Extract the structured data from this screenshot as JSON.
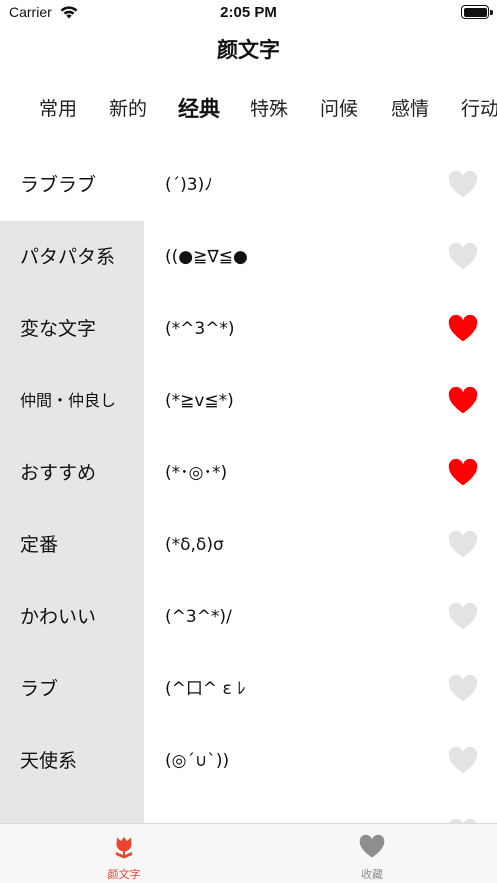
{
  "status_bar": {
    "carrier": "Carrier",
    "time": "2:05 PM"
  },
  "nav": {
    "title": "颜文字"
  },
  "categories": [
    {
      "label": "常用",
      "active": false
    },
    {
      "label": "新的",
      "active": false
    },
    {
      "label": "经典",
      "active": true
    },
    {
      "label": "特殊",
      "active": false
    },
    {
      "label": "问候",
      "active": false
    },
    {
      "label": "感情",
      "active": false
    },
    {
      "label": "行动",
      "active": false
    }
  ],
  "rows": [
    {
      "name": "ラブラブ",
      "kaomoji": "(´)3)ﾉ",
      "favorited": false
    },
    {
      "name": "パタパタ系",
      "kaomoji": "((●≧∇≦●",
      "favorited": false
    },
    {
      "name": "変な文字",
      "kaomoji": "(*^3^*)",
      "favorited": true
    },
    {
      "name": "仲間・仲良し",
      "kaomoji": "(*≧v≦*)",
      "favorited": true
    },
    {
      "name": "おすすめ",
      "kaomoji": "(*･◎･*)",
      "favorited": true
    },
    {
      "name": "定番",
      "kaomoji": "(*δ,δ)σ",
      "favorited": false
    },
    {
      "name": "かわいい",
      "kaomoji": "(^3^*)/",
      "favorited": false
    },
    {
      "name": "ラブ",
      "kaomoji": "(^口^ ε ﾚ",
      "favorited": false
    },
    {
      "name": "天使系",
      "kaomoji": "(◎´∪`))",
      "favorited": false
    },
    {
      "name": "",
      "kaomoji": "(◎ ◎)",
      "favorited": false
    }
  ],
  "tab_bar": {
    "items": [
      {
        "label": "颜文字",
        "icon": "tulip-icon",
        "active": true
      },
      {
        "label": "收藏",
        "icon": "heart-icon",
        "active": false
      }
    ]
  },
  "colors": {
    "heart_on": "#ff0000",
    "heart_off": "#e3e3e3",
    "accent": "#e8452c",
    "tab_inactive": "#8e8e8e",
    "side_bg": "#e6e6e6"
  }
}
